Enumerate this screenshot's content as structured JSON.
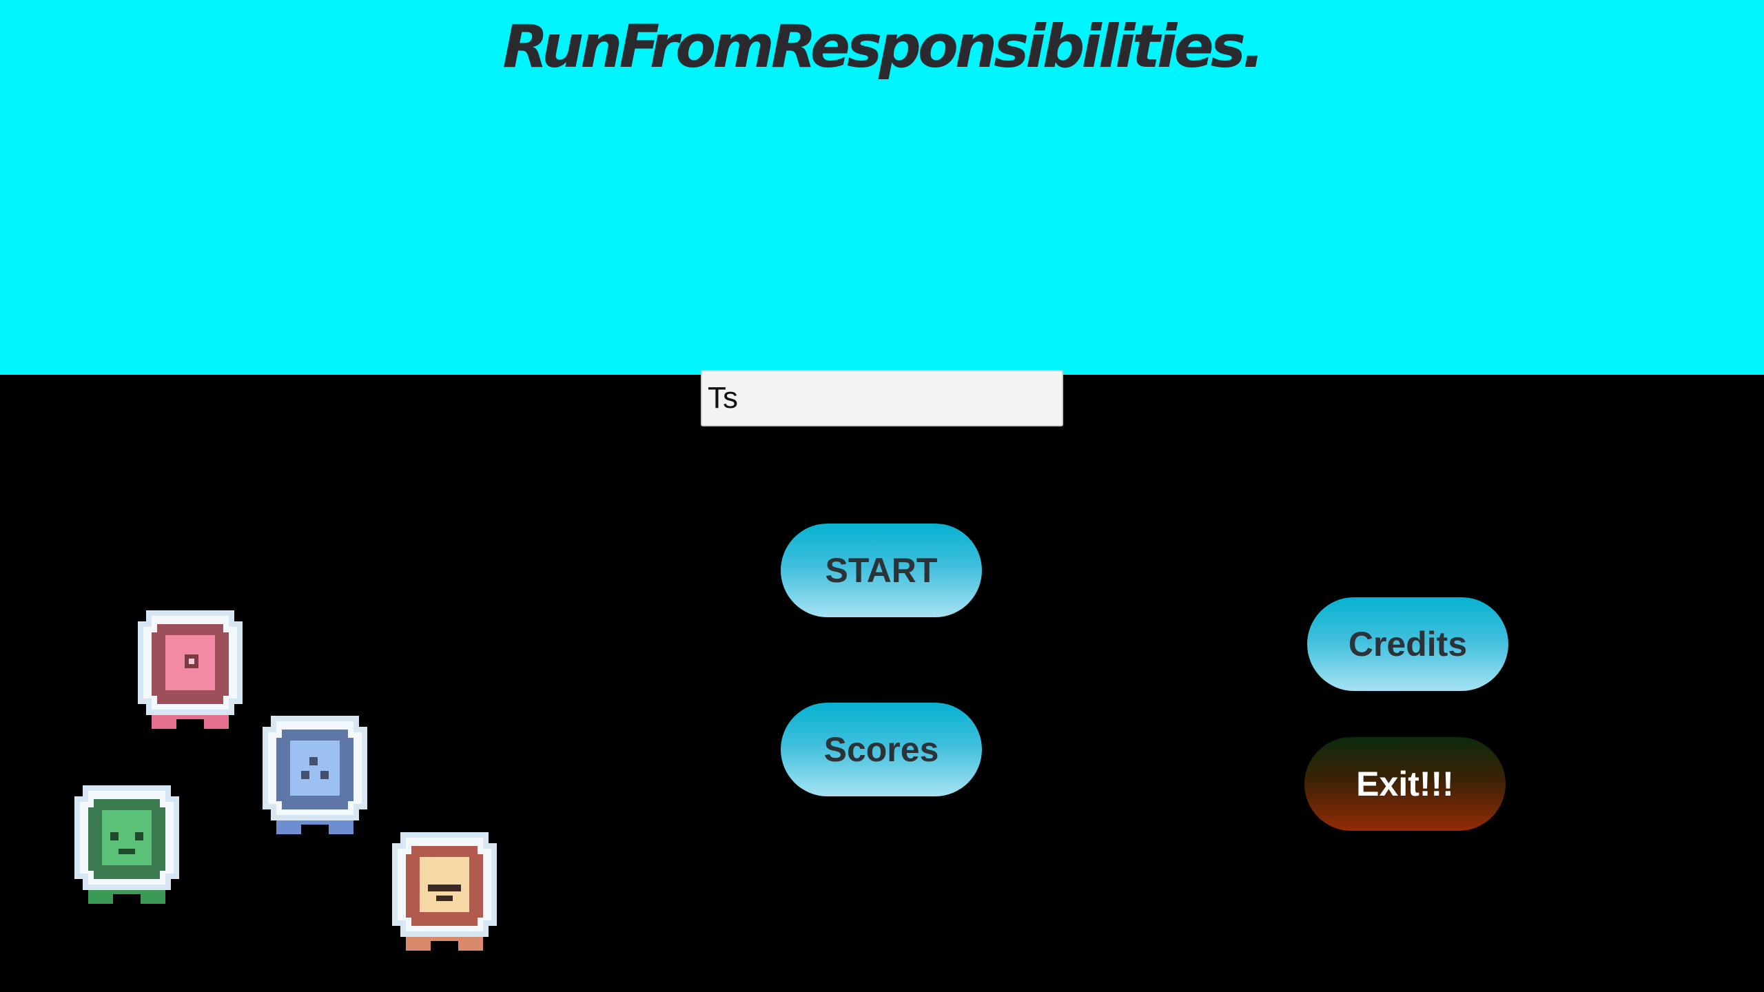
{
  "title": "RunFromResponsibilities.",
  "name_input": {
    "value": "Ts"
  },
  "buttons": {
    "start": "START",
    "scores": "Scores",
    "credits": "Credits",
    "exit": "Exit!!!"
  },
  "colors": {
    "sky": "#00f6ff",
    "ground": "#000000",
    "title": "#2a2a2e",
    "button_top": "#06b2d1",
    "button_bottom": "#a6e2f2",
    "exit_top": "#0c2a0c",
    "exit_bottom": "#932c06"
  },
  "characters": [
    {
      "name": "pink-astronaut-icon",
      "helmet": "#9d4f5a",
      "face": "#f28aa5",
      "feet": "#e56f8f"
    },
    {
      "name": "blue-astronaut-icon",
      "helmet": "#5e77a6",
      "face": "#9dc0f2",
      "feet": "#6d8fd0"
    },
    {
      "name": "green-astronaut-icon",
      "helmet": "#3a7a4e",
      "face": "#5cc27a",
      "feet": "#3a9a55"
    },
    {
      "name": "yellow-astronaut-icon",
      "helmet": "#b15a4d",
      "face": "#f6d9a6",
      "feet": "#d98a6a"
    }
  ]
}
